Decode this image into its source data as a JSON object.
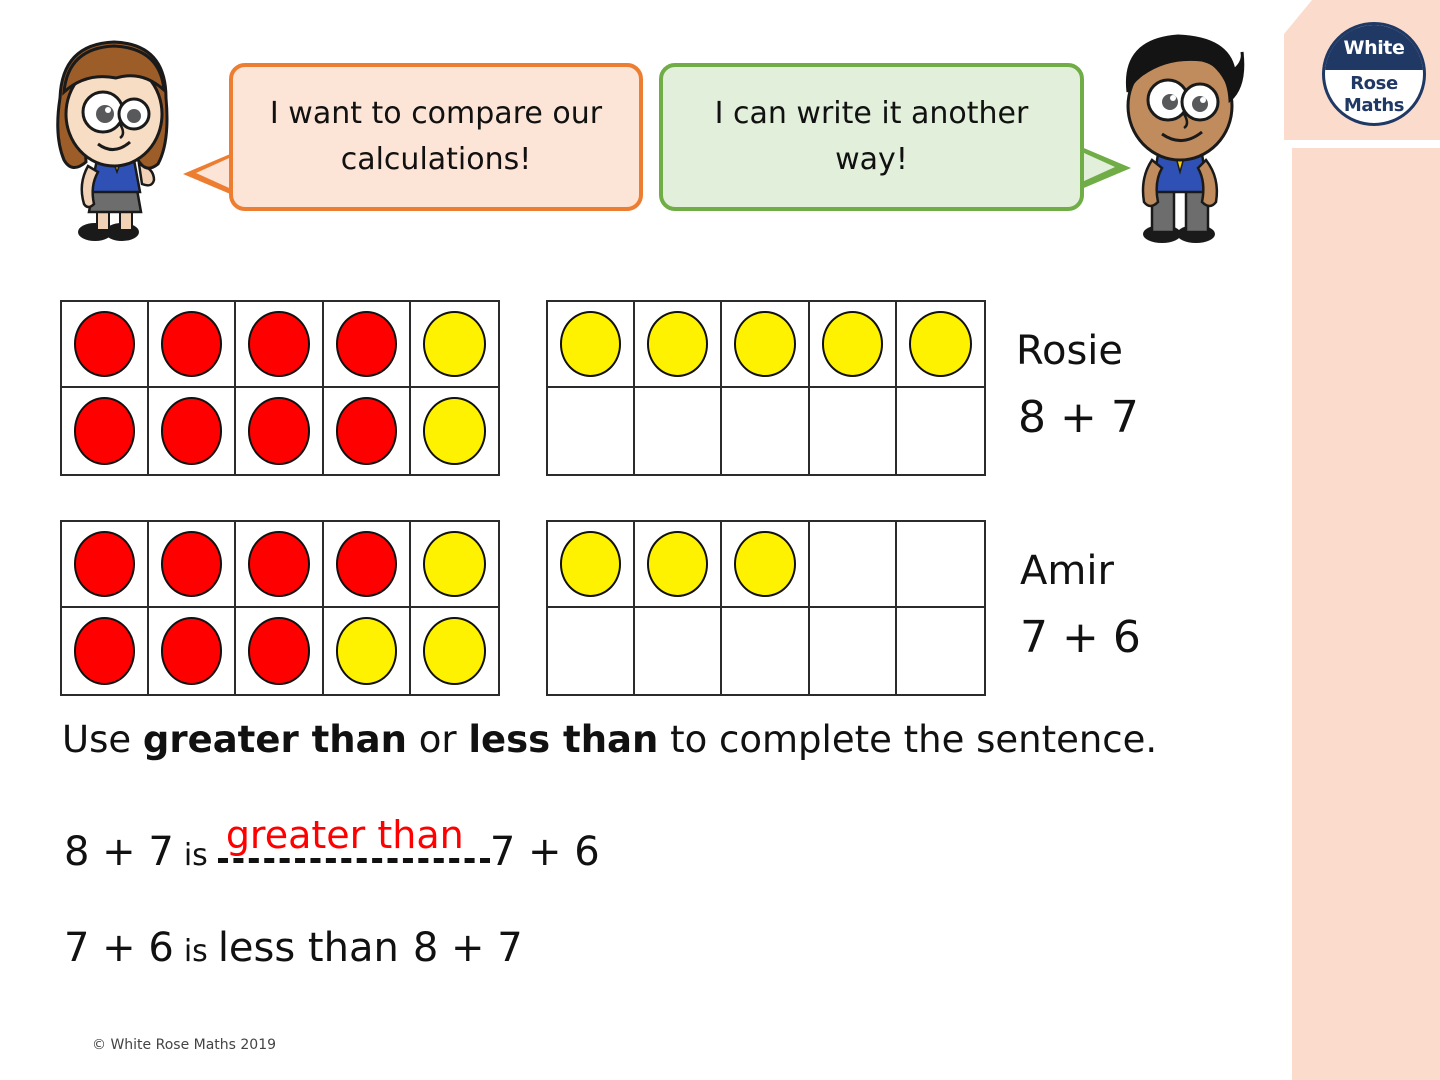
{
  "slide": {
    "copyright": "© White Rose Maths 2019"
  },
  "logo": {
    "line1": "White",
    "line2": "Rose",
    "line3": "Maths"
  },
  "characters": [
    {
      "name": "Rosie",
      "icon": "girl-character"
    },
    {
      "name": "Amir",
      "icon": "boy-character"
    }
  ],
  "bubbles": {
    "rosie": {
      "text": "I want to compare our calculations!",
      "fill": "#FCE4D6",
      "border": "#ED7D31"
    },
    "amir": {
      "text": "I can write it another way!",
      "fill": "#E2EFDA",
      "border": "#70AD47"
    }
  },
  "colors": {
    "red_counter": "#FF0000",
    "yellow_counter": "#FFF200",
    "answer_red": "#FF0000",
    "sidebar": "#FADBCC",
    "logo_navy": "#1F3864"
  },
  "rows": [
    {
      "pupil": "Rosie",
      "calculation": "8 + 7",
      "frames": [
        {
          "cells": [
            "red",
            "red",
            "red",
            "red",
            "yellow",
            "red",
            "red",
            "red",
            "red",
            "yellow"
          ]
        },
        {
          "cells": [
            "yellow",
            "yellow",
            "yellow",
            "yellow",
            "yellow",
            "empty",
            "empty",
            "empty",
            "empty",
            "empty"
          ]
        }
      ]
    },
    {
      "pupil": "Amir",
      "calculation": "7 + 6",
      "frames": [
        {
          "cells": [
            "red",
            "red",
            "red",
            "red",
            "yellow",
            "red",
            "red",
            "red",
            "yellow",
            "yellow"
          ]
        },
        {
          "cells": [
            "yellow",
            "yellow",
            "yellow",
            "empty",
            "empty",
            "empty",
            "empty",
            "empty",
            "empty",
            "empty"
          ]
        }
      ]
    }
  ],
  "question": {
    "part1": "Use ",
    "bold1": "greater than",
    "part2": " or ",
    "bold2": "less than",
    "part3": " to complete the sentence."
  },
  "sentences": [
    {
      "left": "8 + 7",
      "verb": "is",
      "answer": "greater than",
      "right": "7 + 6"
    },
    {
      "full_left": "7 + 6",
      "verb": "is",
      "comparison": "less than",
      "full_right": "8 + 7"
    }
  ]
}
